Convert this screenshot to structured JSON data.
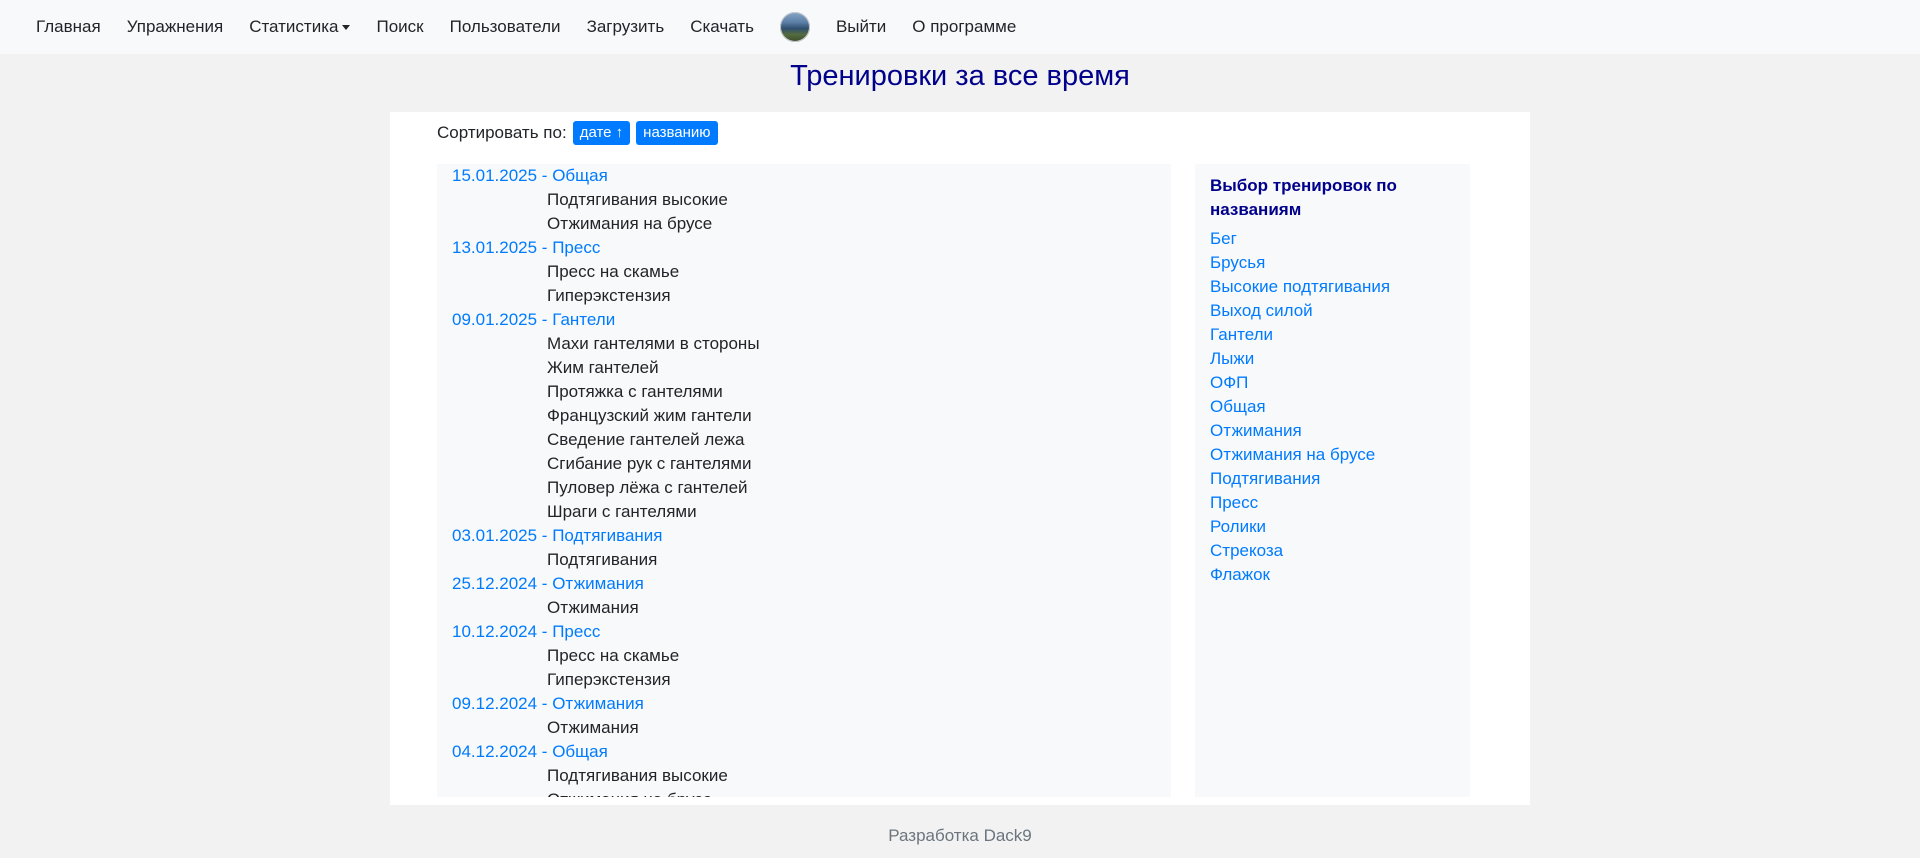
{
  "nav": {
    "items": [
      "Главная",
      "Упражнения",
      "Статистика",
      "Поиск",
      "Пользователи",
      "Загрузить",
      "Скачать"
    ],
    "logout": "Выйти",
    "about": "О программе"
  },
  "page": {
    "title": "Тренировки за все время",
    "sort_label": "Сортировать по:",
    "sort_by_date": "дате ↑",
    "sort_by_name": "названию"
  },
  "workouts": [
    {
      "header": "15.01.2025 - Общая",
      "exercises": [
        "Подтягивания высокие",
        "Отжимания на брусе"
      ]
    },
    {
      "header": "13.01.2025 - Пресс",
      "exercises": [
        "Пресс на скамье",
        "Гиперэкстензия"
      ]
    },
    {
      "header": "09.01.2025 - Гантели",
      "exercises": [
        "Махи гантелями в стороны",
        "Жим гантелей",
        "Протяжка с гантелями",
        "Французский жим гантели",
        "Сведение гантелей лежа",
        "Сгибание рук с гантелями",
        "Пуловер лёжа с гантелей",
        "Шраги с гантелями"
      ]
    },
    {
      "header": "03.01.2025 - Подтягивания",
      "exercises": [
        "Подтягивания"
      ]
    },
    {
      "header": "25.12.2024 - Отжимания",
      "exercises": [
        "Отжимания"
      ]
    },
    {
      "header": "10.12.2024 - Пресс",
      "exercises": [
        "Пресс на скамье",
        "Гиперэкстензия"
      ]
    },
    {
      "header": "09.12.2024 - Отжимания",
      "exercises": [
        "Отжимания"
      ]
    },
    {
      "header": "04.12.2024 - Общая",
      "exercises": [
        "Подтягивания высокие",
        "Отжимания на брусе"
      ]
    }
  ],
  "sidebar": {
    "title": "Выбор тренировок по названиям",
    "links": [
      "Бег",
      "Брусья",
      "Высокие подтягивания",
      "Выход силой",
      "Гантели",
      "Лыжи",
      "ОФП",
      "Общая",
      "Отжимания",
      "Отжимания на брусе",
      "Подтягивания",
      "Пресс",
      "Ролики",
      "Стрекоза",
      "Флажок"
    ]
  },
  "footer": "Разработка Dack9"
}
